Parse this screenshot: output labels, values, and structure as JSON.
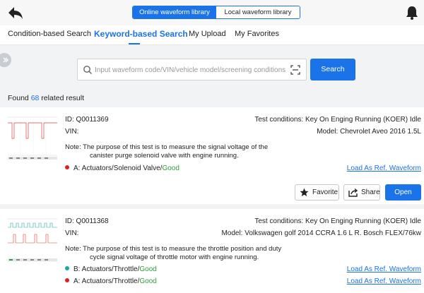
{
  "header": {
    "segments": [
      "Online waveform library",
      "Local waveform library"
    ],
    "active_segment": 0
  },
  "tabs": [
    "Condition-based Search",
    "Keyword-based Search",
    "My Upload",
    "My Favorites"
  ],
  "active_tab": 1,
  "search": {
    "placeholder": "Input waveform code/VIN/vehicle model/screening conditions",
    "value": "",
    "button_label": "Search"
  },
  "results": {
    "prefix": "Found ",
    "count": "68",
    "suffix": " related result"
  },
  "cards": [
    {
      "id": "ID: Q0011369",
      "vin": "VIN:",
      "test_conditions": "Test conditions: Key On Enging Running (KOER) Idle",
      "model": "Model: Chevrolet Aveo 2016 1.5L",
      "note_line1": "Note: The purpose of this test is to measure the signal voltage of the",
      "note_line2": "canister purge solenoid valve with engine running.",
      "channels": [
        {
          "prefix": "A:  Actuators/Solenoid Valve/",
          "status": "Good",
          "color": "#e02020",
          "link": "Load As Ref. Waveform"
        }
      ],
      "buttons": {
        "favorite": "Favorite",
        "share": "Share",
        "open": "Open"
      }
    },
    {
      "id": "ID: Q0011368",
      "vin": "VIN:",
      "test_conditions": "Test conditions: Key On Enging Running (KOER) Idle",
      "model": "Model: Volkswagen golf 2014 CCRA 1.6 L R. Bosch FLEX/76kw",
      "note_line1": "Note: The purpose of this test is to measure the throttle position and duty",
      "note_line2": "cycle signal voltage of throttle motor with engine running.",
      "channels": [
        {
          "prefix": "B:  Actuators/Throttle/",
          "status": "Good",
          "color": "#1aa9a0",
          "link": "Load As Ref. Waveform"
        },
        {
          "prefix": "A:  Actuators/Throttle/",
          "status": "Good",
          "color": "#e02020",
          "link": "Load As Ref. Waveform"
        }
      ]
    }
  ],
  "icons": {
    "back": "back-arrow-icon",
    "bell": "bell-icon",
    "search": "search-icon",
    "scan": "scan-icon",
    "favorite": "star-icon",
    "share": "share-icon"
  },
  "colors": {
    "accent": "#1a73e8",
    "good": "#2e9e3a",
    "channel_a": "#e02020",
    "channel_b": "#1aa9a0"
  }
}
